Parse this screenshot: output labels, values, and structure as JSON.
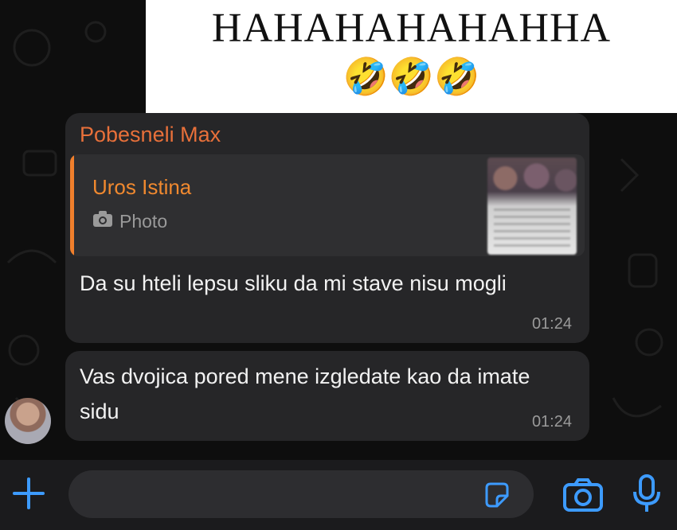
{
  "caption": {
    "text": "HAHAHAHAHAHHA",
    "emoji": "🤣🤣🤣"
  },
  "messages": [
    {
      "sender": "Pobesneli Max",
      "reply": {
        "author": "Uros Istina",
        "type_label": "Photo"
      },
      "text": "Da su hteli lepsu sliku da mi stave nisu mogli",
      "time": "01:24"
    },
    {
      "text": "Vas dvojica pored mene izgledate kao da imate sidu",
      "time": "01:24"
    }
  ],
  "composer": {
    "icons": [
      "plus-icon",
      "sticker-icon",
      "camera-icon",
      "microphone-icon"
    ],
    "accent_color": "#3d9bff"
  },
  "colors": {
    "sender": "#e8703a",
    "reply_bar": "#f07f2c",
    "bubble": "#262628"
  }
}
